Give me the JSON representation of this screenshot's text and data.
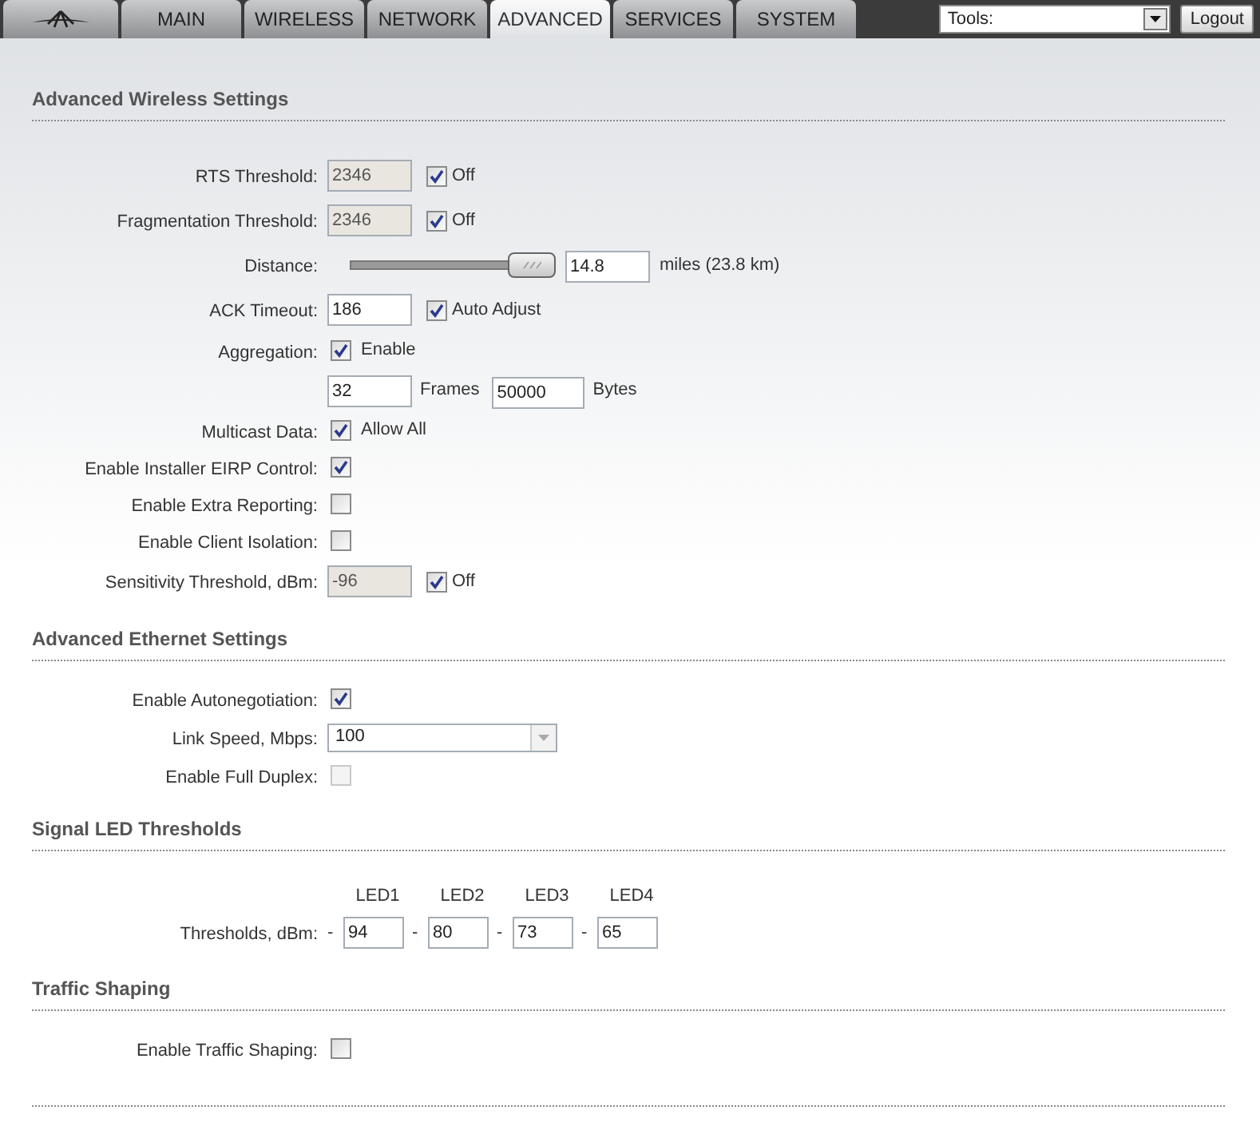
{
  "header": {
    "tabs": [
      {
        "kind": "logo",
        "selected": false
      },
      {
        "kind": "text",
        "label": "MAIN",
        "selected": false
      },
      {
        "kind": "text",
        "label": "WIRELESS",
        "selected": false
      },
      {
        "kind": "text",
        "label": "NETWORK",
        "selected": false
      },
      {
        "kind": "text",
        "label": "ADVANCED",
        "selected": true
      },
      {
        "kind": "text",
        "label": "SERVICES",
        "selected": false
      },
      {
        "kind": "text",
        "label": "SYSTEM",
        "selected": false
      }
    ],
    "tools": {
      "value": "Tools:"
    },
    "logout": "Logout"
  },
  "sections": [
    {
      "title": "Advanced Wireless Settings",
      "rows": [
        {
          "kind": "input_check",
          "label": "RTS Threshold:",
          "value": "2346",
          "disabled": true,
          "checked": true,
          "check_label": "Off"
        },
        {
          "kind": "input_check",
          "label": "Fragmentation Threshold:",
          "value": "2346",
          "disabled": true,
          "checked": true,
          "check_label": "Off"
        },
        {
          "kind": "slider",
          "label": "Distance:",
          "level": 1,
          "value": "14.8",
          "unit": "miles (23.8 km)"
        },
        {
          "kind": "input_check",
          "label": "ACK Timeout:",
          "value": "186",
          "disabled": false,
          "checked": true,
          "check_label": "Auto Adjust"
        },
        {
          "kind": "check",
          "label": "Aggregation:",
          "checked": true,
          "disabled": false,
          "check_label": "Enable"
        },
        {
          "kind": "pair",
          "value1": "32",
          "label1": "Frames",
          "value2": "50000",
          "label2": "Bytes"
        },
        {
          "kind": "check",
          "label": "Multicast Data:",
          "checked": true,
          "disabled": false,
          "check_label": "Allow All"
        },
        {
          "kind": "check",
          "label": "Enable Installer EIRP Control:",
          "checked": true,
          "disabled": false
        },
        {
          "kind": "check",
          "label": "Enable Extra Reporting:",
          "checked": false,
          "disabled": false
        },
        {
          "kind": "check",
          "label": "Enable Client Isolation:",
          "checked": false,
          "disabled": false
        },
        {
          "kind": "input_check",
          "label": "Sensitivity Threshold, dBm:",
          "value": "-96",
          "disabled": true,
          "checked": true,
          "check_label": "Off"
        }
      ]
    },
    {
      "title": "Advanced Ethernet Settings",
      "rows": [
        {
          "kind": "check",
          "label": "Enable Autonegotiation:",
          "checked": true,
          "disabled": false
        },
        {
          "kind": "select",
          "label": "Link Speed, Mbps:",
          "value": "100",
          "disabled": true
        },
        {
          "kind": "check",
          "label": "Enable Full Duplex:",
          "checked": false,
          "disabled": true
        }
      ]
    },
    {
      "title": "Signal LED Thresholds",
      "rows": [
        {
          "kind": "led",
          "label": "Thresholds, dBm:",
          "items": [
            {
              "header": "LED1",
              "separator": "-",
              "value": "94"
            },
            {
              "header": "LED2",
              "separator": "-",
              "value": "80"
            },
            {
              "header": "LED3",
              "separator": "-",
              "value": "73"
            },
            {
              "header": "LED4",
              "separator": "-",
              "value": "65"
            }
          ]
        }
      ]
    },
    {
      "title": "Traffic Shaping",
      "rows": [
        {
          "kind": "check",
          "label": "Enable Traffic Shaping:",
          "checked": false,
          "disabled": false
        }
      ]
    }
  ]
}
